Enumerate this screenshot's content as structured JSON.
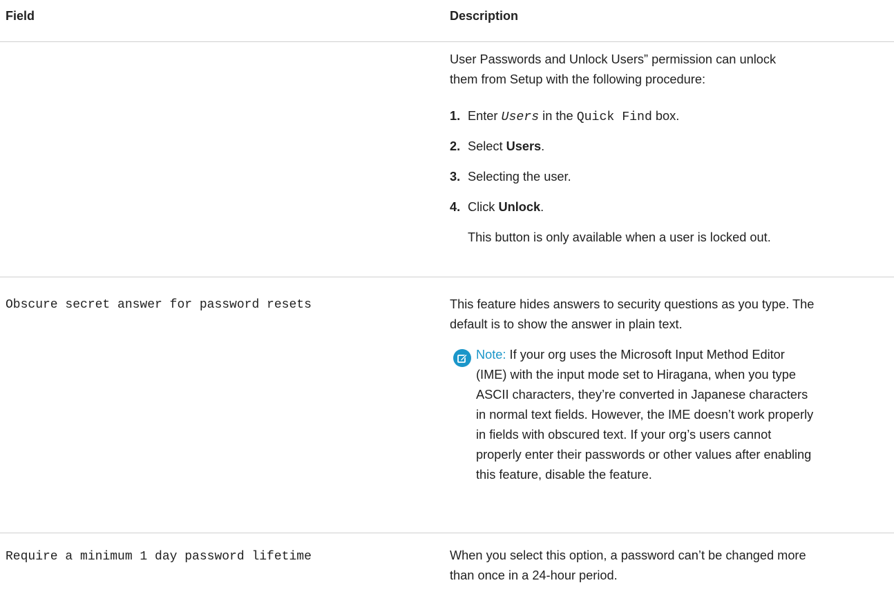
{
  "table": {
    "headers": {
      "field": "Field",
      "description": "Description"
    },
    "row1": {
      "intro_line1": "User Passwords and Unlock Users” permission can unlock",
      "intro_line2": "them from Setup with the following procedure:",
      "steps": [
        {
          "num": "1.",
          "pre": "Enter ",
          "code_italic": "Users",
          "mid": " in the ",
          "code": "Quick Find",
          "post": " box."
        },
        {
          "num": "2.",
          "pre": "Select ",
          "bold": "Users",
          "post": "."
        },
        {
          "num": "3.",
          "text": "Selecting the user."
        },
        {
          "num": "4.",
          "pre": "Click ",
          "bold": "Unlock",
          "post": "."
        }
      ],
      "step4_note": "This button is only available when a user is locked out."
    },
    "row2": {
      "field": "Obscure secret answer for password resets",
      "desc_line1": "This feature hides answers to security questions as you type. The",
      "desc_line2": "default is to show the answer in plain text.",
      "note_label": "Note:",
      "note_lines": [
        " If your org uses the Microsoft Input Method Editor",
        "(IME) with the input mode set to Hiragana, when you type",
        "ASCII characters, they’re converted in Japanese characters",
        "in normal text fields. However, the IME doesn’t work properly",
        "in fields with obscured text. If your org’s users cannot",
        "properly enter their passwords or other values after enabling",
        "this feature, disable the feature."
      ]
    },
    "row3": {
      "field": "Require a minimum 1 day password lifetime",
      "desc_line1": "When you select this option, a password can’t be changed more",
      "desc_line2": "than once in a 24-hour period."
    }
  },
  "icons": {
    "note": "edit-note-icon"
  },
  "colors": {
    "note_accent": "#1b96c9",
    "rule": "#cfcfcf"
  }
}
